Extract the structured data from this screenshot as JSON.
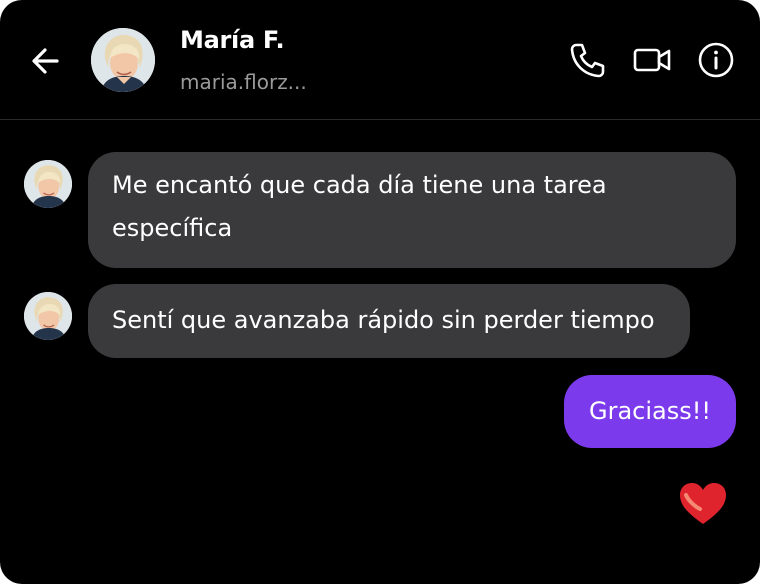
{
  "header": {
    "name": "María F.",
    "handle": "maria.florz..."
  },
  "icons": {
    "back": "arrow-left-icon",
    "call": "phone-icon",
    "video": "video-camera-icon",
    "info": "info-icon",
    "reaction": "heart-icon"
  },
  "messages": [
    {
      "direction": "incoming",
      "text": "Me encantó que cada día tiene una tarea específica"
    },
    {
      "direction": "incoming",
      "text": "Sentí que avanzaba rápido sin perder tiempo"
    },
    {
      "direction": "outgoing",
      "text": "Graciass!!"
    }
  ],
  "colors": {
    "background": "#000000",
    "incoming_bubble": "#3a3a3c",
    "outgoing_bubble": "#7c3aed",
    "heart": "#e0242e"
  }
}
